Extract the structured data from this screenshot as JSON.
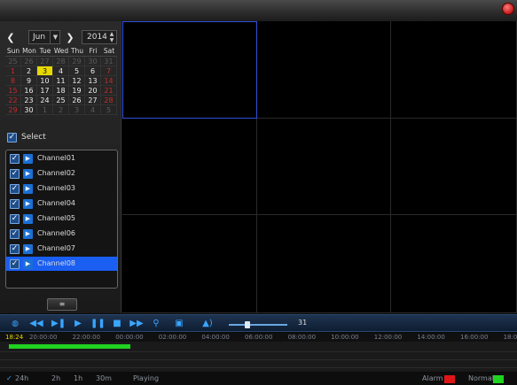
{
  "calendar": {
    "month": "Jun",
    "year": "2014",
    "weekdays": [
      "Sun",
      "Mon",
      "Tue",
      "Wed",
      "Thu",
      "Fri",
      "Sat"
    ],
    "days": [
      [
        "25",
        "26",
        "27",
        "28",
        "29",
        "30",
        "31"
      ],
      [
        "1",
        "2",
        "3",
        "4",
        "5",
        "6",
        "7"
      ],
      [
        "8",
        "9",
        "10",
        "11",
        "12",
        "13",
        "14"
      ],
      [
        "15",
        "16",
        "17",
        "18",
        "19",
        "20",
        "21"
      ],
      [
        "22",
        "23",
        "24",
        "25",
        "26",
        "27",
        "28"
      ],
      [
        "29",
        "30",
        "1",
        "2",
        "3",
        "4",
        "5"
      ]
    ],
    "selected_day": "3"
  },
  "channels": {
    "select_label": "Select",
    "items": [
      "Channel01",
      "Channel02",
      "Channel03",
      "Channel04",
      "Channel05",
      "Channel06",
      "Channel07",
      "Channel08"
    ],
    "active_index": 7,
    "list_button_glyph": "≡"
  },
  "toolbar": {
    "volume": 31,
    "volume_fraction": 0.32
  },
  "timeline": {
    "current_time": "18:24",
    "ticks": [
      "20:00:00",
      "22:00:00",
      "00:00:00",
      "02:00:00",
      "04:00:00",
      "06:00:00",
      "08:00:00",
      "10:00:00",
      "12:00:00",
      "14:00:00",
      "16:00:00",
      "18:00"
    ]
  },
  "status": {
    "ranges": [
      "24h",
      "2h",
      "1h",
      "30m"
    ],
    "playing": "Playing",
    "alarm_label": "Alarm",
    "normal_label": "Normal",
    "alarm_color": "#e01616",
    "normal_color": "#1fd31f"
  },
  "icons": {
    "close": "close-icon",
    "record": "record-icon",
    "rewind": "fast-backward-icon",
    "step": "step-forward-icon",
    "play": "play-icon",
    "pause": "pause-icon",
    "stop": "stop-icon",
    "forward": "fast-forward-icon",
    "zoom": "zoom-icon",
    "fullscreen": "fullscreen-icon",
    "volume": "volume-icon"
  }
}
